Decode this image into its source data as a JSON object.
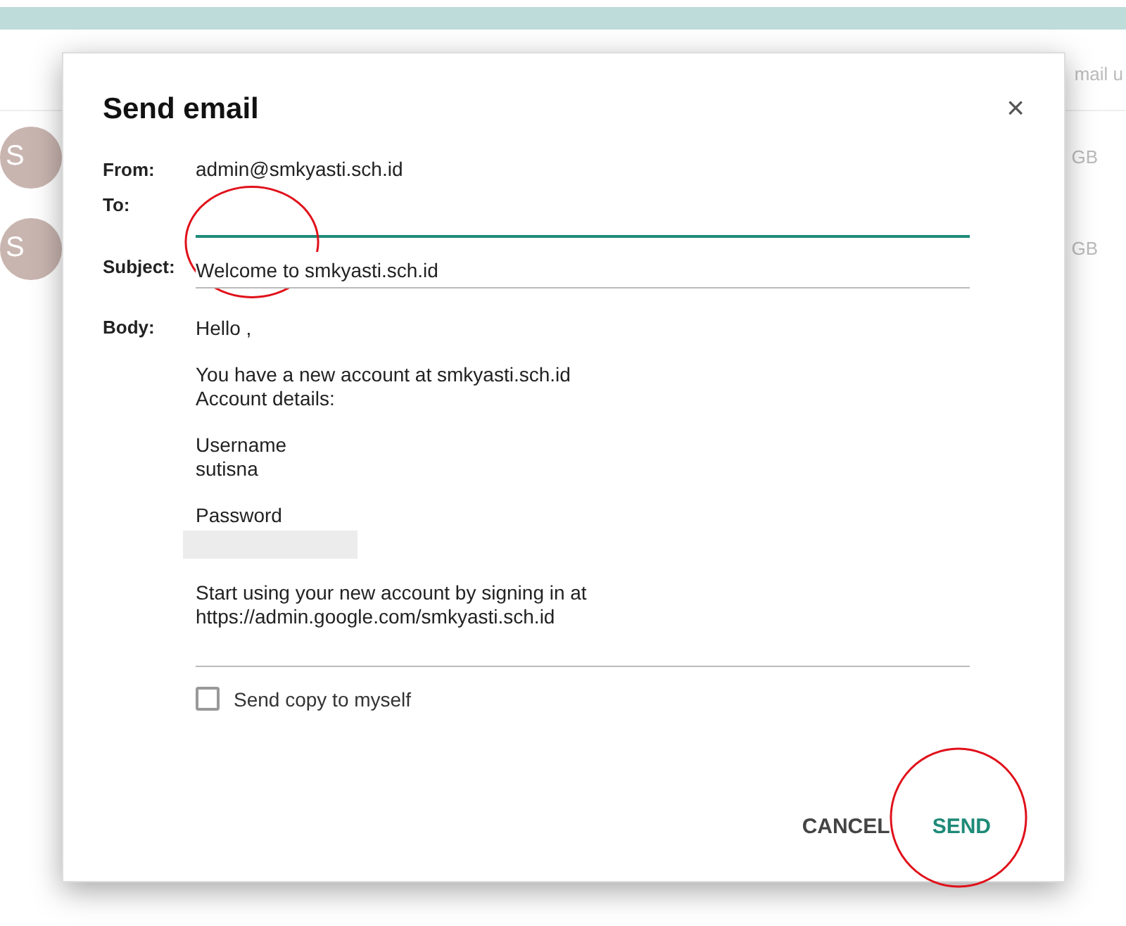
{
  "background": {
    "header_text": "mail u",
    "rows": [
      {
        "avatar": "S",
        "size": "GB"
      },
      {
        "avatar": "S",
        "size": "GB"
      }
    ]
  },
  "dialog": {
    "title": "Send email",
    "close": "×",
    "fields": [
      {
        "label": "From:",
        "kind": "text",
        "value": "admin@smkyasti.sch.id",
        "circled": false
      },
      {
        "label": "To:",
        "kind": "input",
        "focused": true,
        "circled": true
      },
      {
        "label": "Subject:",
        "kind": "input",
        "value": "Welcome to smkyasti.sch.id",
        "focused": false,
        "circled": false
      }
    ],
    "body": {
      "label": "Body:",
      "paragraphs": [
        {
          "kind": "text",
          "lines": [
            "Hello ,"
          ]
        },
        {
          "kind": "text",
          "lines": [
            "You have a new account at smkyasti.sch.id",
            "Account details:"
          ]
        },
        {
          "kind": "text",
          "lines": [
            "Username",
            "sutisna"
          ]
        },
        {
          "kind": "redacted",
          "lines": [
            "Password"
          ]
        },
        {
          "kind": "text",
          "lines": [
            "Start using your new account by signing in at",
            "https://admin.google.com/smkyasti.sch.id"
          ]
        }
      ]
    },
    "copy": {
      "label": "Send copy to myself",
      "checked": false
    },
    "buttons": [
      {
        "label": "CANCEL",
        "kind": "plain",
        "circled": false
      },
      {
        "label": "SEND",
        "kind": "primary",
        "circled": true
      }
    ]
  }
}
